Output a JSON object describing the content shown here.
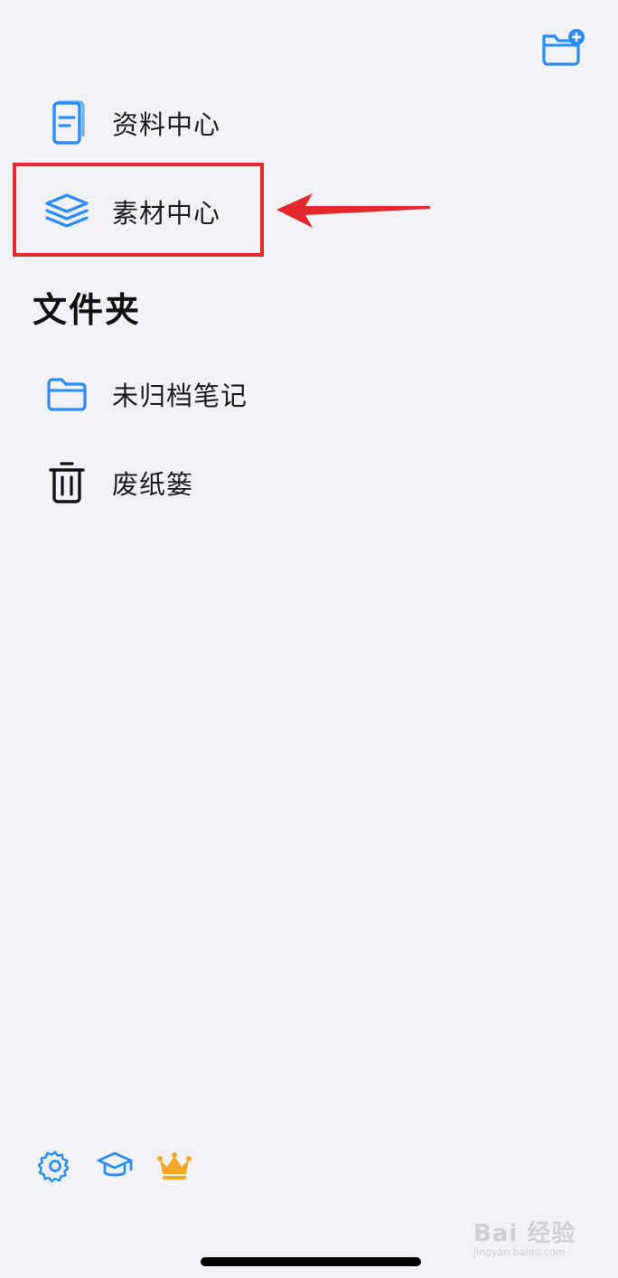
{
  "top_bar": {
    "new_folder_icon": "folder-plus-icon"
  },
  "nav": {
    "items": [
      {
        "label": "资料中心",
        "icon": "document-book-icon"
      },
      {
        "label": "素材中心",
        "icon": "layers-icon"
      }
    ]
  },
  "folders": {
    "title": "文件夹",
    "items": [
      {
        "label": "未归档笔记",
        "icon": "folder-icon"
      },
      {
        "label": "废纸篓",
        "icon": "trash-icon"
      }
    ]
  },
  "bottom_bar": {
    "items": [
      {
        "icon": "gear-icon"
      },
      {
        "icon": "graduation-cap-icon"
      },
      {
        "icon": "crown-icon"
      }
    ]
  },
  "colors": {
    "accent": "#2a8cf7",
    "highlight": "#e3282e",
    "crown": "#f5a623",
    "background": "#f2f1f6"
  },
  "watermark": {
    "main": "Bai 经验",
    "sub": "jingyan.baidu.com"
  }
}
